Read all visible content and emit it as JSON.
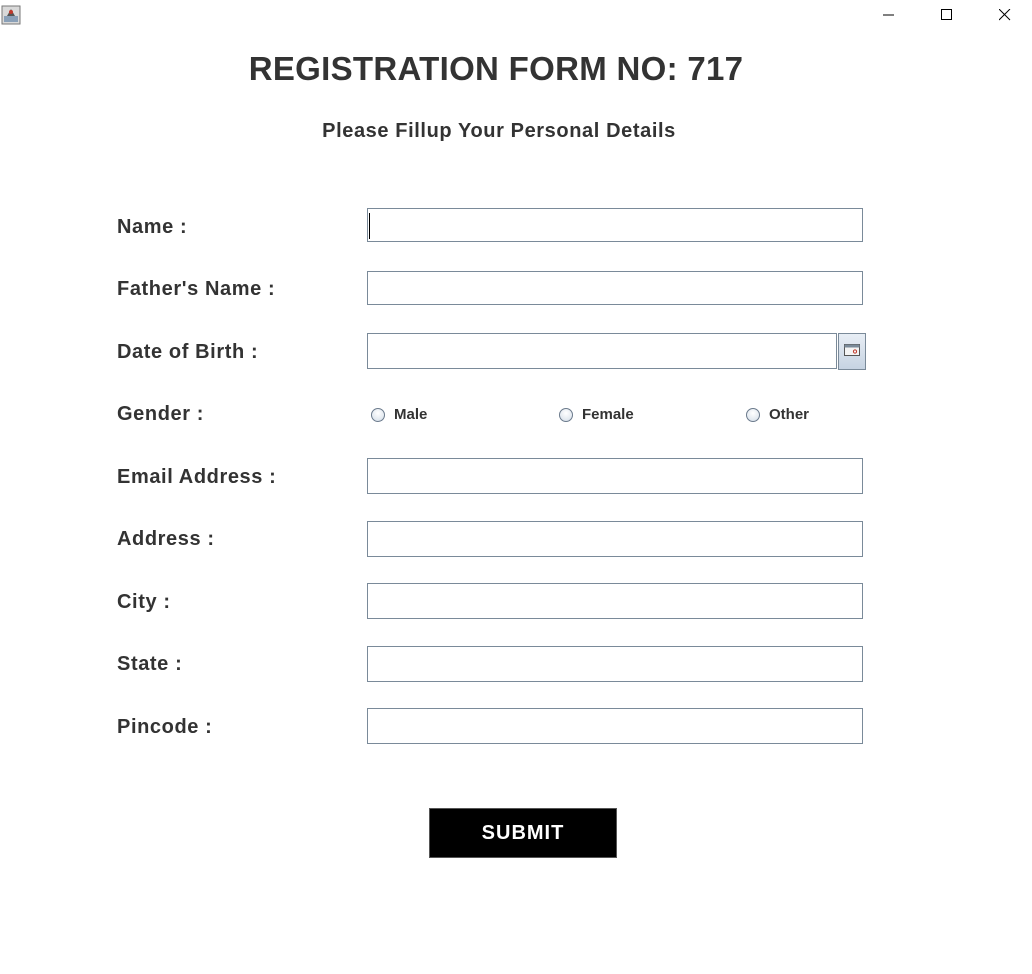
{
  "window": {
    "controls": {
      "minimize_icon": "minimize-icon",
      "maximize_icon": "maximize-icon",
      "close_icon": "close-icon"
    }
  },
  "form": {
    "title": "REGISTRATION FORM NO: 717",
    "subtitle": "Please Fillup Your Personal Details",
    "fields": {
      "name": {
        "label": "Name :",
        "value": ""
      },
      "fathers_name": {
        "label": "Father's Name :",
        "value": ""
      },
      "dob": {
        "label": "Date of Birth :",
        "value": "",
        "icon": "calendar-icon"
      },
      "gender": {
        "label": "Gender :",
        "options": [
          "Male",
          "Female",
          "Other"
        ],
        "selected": null
      },
      "email": {
        "label": "Email Address :",
        "value": ""
      },
      "address": {
        "label": "Address :",
        "value": ""
      },
      "city": {
        "label": "City :",
        "value": ""
      },
      "state": {
        "label": "State :",
        "value": ""
      },
      "pincode": {
        "label": "Pincode :",
        "value": ""
      }
    },
    "submit_label": "SUBMIT"
  },
  "colors": {
    "text": "#333333",
    "field_border": "#7a8a99",
    "submit_bg": "#000000",
    "submit_text": "#ffffff"
  }
}
